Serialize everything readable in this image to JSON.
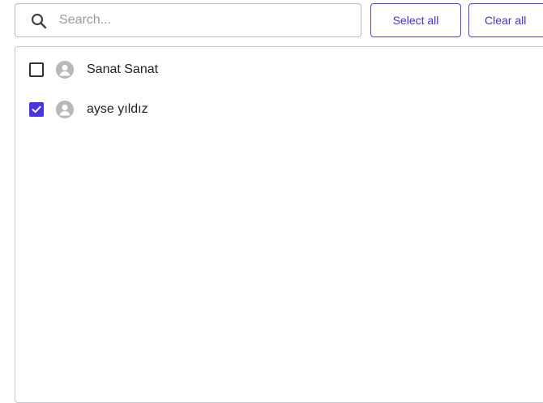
{
  "search": {
    "placeholder": "Search...",
    "value": ""
  },
  "buttons": {
    "select_all": "Select all",
    "clear_all": "Clear all"
  },
  "list": {
    "items": [
      {
        "name": "Sanat Sanat",
        "checked": false,
        "avatar_icon": "person-icon"
      },
      {
        "name": "ayse yıldız",
        "checked": true,
        "avatar_icon": "person-icon"
      }
    ]
  },
  "colors": {
    "accent": "#4a34e0",
    "avatar_bg": "#b8b8b8",
    "border": "#c9c9cf"
  }
}
